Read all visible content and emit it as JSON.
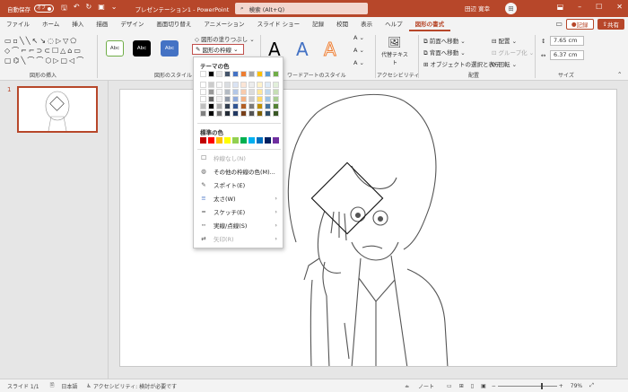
{
  "titlebar": {
    "autosave_label": "自動保存",
    "autosave_state": "オフ",
    "title": "プレゼンテーション1 - PowerPoint",
    "search_placeholder": "検索 (Alt+Q)",
    "user_name": "田辺 寛幸",
    "user_initials": "田"
  },
  "tabs": [
    "ファイル",
    "ホーム",
    "挿入",
    "描画",
    "デザイン",
    "画面切り替え",
    "アニメーション",
    "スライド ショー",
    "記録",
    "校閲",
    "表示",
    "ヘルプ",
    "図形の書式"
  ],
  "active_tab": "図形の書式",
  "tab_actions": {
    "record": "記録",
    "share": "共有"
  },
  "ribbon": {
    "insert_shapes_group": "図形の挿入",
    "shape_styles_group": "図形のスタイル",
    "wordart_group": "ワードアートのスタイル",
    "accessibility_group": "アクセシビリティ",
    "arrange_group": "配置",
    "size_group": "サイズ",
    "style_abc": "Abc",
    "fill_label": "図形の塗りつぶし",
    "outline_label": "図形の枠線",
    "alt_text_label": "代替テキスト",
    "bring_forward": "前面へ移動",
    "send_backward": "背面へ移動",
    "selection_pane": "オブジェクトの選択と表示",
    "align": "配置",
    "group": "グループ化",
    "rotate": "回転",
    "height": "7.65 cm",
    "width": "6.37 cm",
    "wordart_letter": "A"
  },
  "dropdown": {
    "theme_colors_header": "テーマの色",
    "standard_colors_header": "標準の色",
    "no_outline": "枠線なし(N)",
    "more_colors": "その他の枠線の色(M)...",
    "eyedropper": "スポイト(E)",
    "weight": "太さ(W)",
    "sketch": "スケッチ(E)",
    "dashes": "実線/点線(S)",
    "arrows": "矢印(R)"
  },
  "theme_colors": [
    "#ffffff",
    "#000000",
    "#e7e6e6",
    "#44546a",
    "#4472c4",
    "#ed7d31",
    "#a5a5a5",
    "#ffc000",
    "#5b9bd5",
    "#70ad47"
  ],
  "standard_colors": [
    "#c00000",
    "#ff0000",
    "#ffc000",
    "#ffff00",
    "#92d050",
    "#00b050",
    "#00b0f0",
    "#0070c0",
    "#002060",
    "#7030a0"
  ],
  "slide_panel": {
    "slide_number": "1"
  },
  "statusbar": {
    "slide_info": "スライド 1/1",
    "language": "日本語",
    "accessibility": "アクセシビリティ: 検討が必要です",
    "notes": "ノート",
    "zoom": "79%"
  }
}
